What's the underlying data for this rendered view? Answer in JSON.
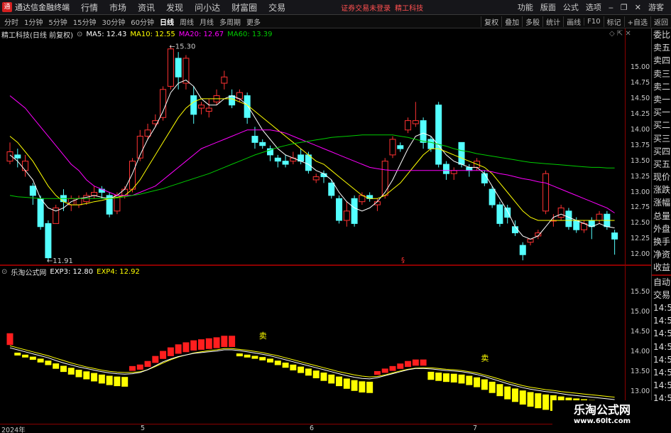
{
  "app": {
    "name": "通达信金融终端",
    "logo": "通",
    "menus": [
      "行情",
      "市场",
      "资讯",
      "发现",
      "问小达",
      "财富圈",
      "交易"
    ],
    "warning": "证券交易未登录",
    "stock_name_top": "精工科技",
    "right_menus": [
      "功能",
      "版面",
      "公式",
      "选项"
    ],
    "window_icons": [
      "minimize-icon",
      "restore-icon",
      "close-icon"
    ],
    "user": "游客"
  },
  "toolbar": {
    "periods": [
      "分时",
      "1分钟",
      "5分钟",
      "15分钟",
      "30分钟",
      "60分钟",
      "日线",
      "周线",
      "月线",
      "多周期",
      "更多"
    ],
    "active": "日线",
    "right": [
      "复权",
      "叠加",
      "多股",
      "统计",
      "画线",
      "F10",
      "标记",
      "+自选",
      "返回"
    ]
  },
  "main": {
    "title": "精工科技(日线 前复权)",
    "ma": [
      {
        "label": "MA5: 12.43",
        "color": "#ffffff"
      },
      {
        "label": "MA10: 12.55",
        "color": "#ffff00"
      },
      {
        "label": "MA20: 12.67",
        "color": "#ff00ff"
      },
      {
        "label": "MA60: 13.39",
        "color": "#00cc00"
      }
    ],
    "high_label": "15.30",
    "low_label": "11.91",
    "mid_marker": "§"
  },
  "price_axis": [
    "15.00",
    "14.75",
    "14.50",
    "14.25",
    "14.00",
    "13.75",
    "13.50",
    "13.25",
    "13.00",
    "12.75",
    "12.50",
    "12.25",
    "12.00"
  ],
  "sub": {
    "title": "乐淘公式网",
    "exp": [
      {
        "label": "EXP3: 12.80",
        "color": "#ffffff"
      },
      {
        "label": "EXP4: 12.92",
        "color": "#ffff00"
      }
    ],
    "sell": "卖"
  },
  "sub_axis": [
    "15.50",
    "15.00",
    "14.50",
    "14.00",
    "13.50",
    "13.00",
    "12.50"
  ],
  "side_quote": [
    "委比",
    "卖五",
    "卖四",
    "卖三",
    "卖二",
    "卖一",
    "买一",
    "买二",
    "买三",
    "买四",
    "买五",
    "现价",
    "涨跌",
    "涨幅",
    "总量",
    "外盘",
    "换手",
    "净资",
    "收益"
  ],
  "side_sub": [
    "自动",
    "交易",
    "14:56",
    "14:56",
    "14:56",
    "14:56",
    "14:56",
    "14:56",
    "14:56",
    "14:56"
  ],
  "xaxis": [
    {
      "t": "2024年",
      "x": 2
    },
    {
      "t": "5",
      "x": 198
    },
    {
      "t": "6",
      "x": 436
    },
    {
      "t": "7",
      "x": 666
    }
  ],
  "watermark": {
    "line1": "乐淘公式网",
    "line2": "www.60lt.com"
  },
  "chart_data": {
    "type": "candlestick",
    "ylim": [
      11.9,
      15.4
    ],
    "candles": [
      [
        13.5,
        13.65,
        13.45,
        13.8
      ],
      [
        13.6,
        13.55,
        13.4,
        13.7
      ],
      [
        13.35,
        13.5,
        13.25,
        13.6
      ],
      [
        13.1,
        12.95,
        12.8,
        13.15
      ],
      [
        12.9,
        12.45,
        12.4,
        12.95
      ],
      [
        12.5,
        11.95,
        11.9,
        12.55
      ],
      [
        12.5,
        12.75,
        12.5,
        12.8
      ],
      [
        12.95,
        12.85,
        12.7,
        13.05
      ],
      [
        12.8,
        12.9,
        12.7,
        12.95
      ],
      [
        12.8,
        12.9,
        12.75,
        12.95
      ],
      [
        12.85,
        12.95,
        12.8,
        13.0
      ],
      [
        12.95,
        13.0,
        12.9,
        13.1
      ],
      [
        13.05,
        13.0,
        12.9,
        13.1
      ],
      [
        12.95,
        12.65,
        12.6,
        13.0
      ],
      [
        12.7,
        12.95,
        12.65,
        13.0
      ],
      [
        12.95,
        13.05,
        12.9,
        13.1
      ],
      [
        13.05,
        13.5,
        13.0,
        13.55
      ],
      [
        13.55,
        13.9,
        13.5,
        14.0
      ],
      [
        13.9,
        14.0,
        13.85,
        14.1
      ],
      [
        14.1,
        14.15,
        14.05,
        14.25
      ],
      [
        14.2,
        14.65,
        14.15,
        14.7
      ],
      [
        14.7,
        15.3,
        14.65,
        15.35
      ],
      [
        15.15,
        14.85,
        14.65,
        15.25
      ],
      [
        14.75,
        15.15,
        14.65,
        15.2
      ],
      [
        14.55,
        14.25,
        14.1,
        14.7
      ],
      [
        14.35,
        14.4,
        14.25,
        14.45
      ],
      [
        14.3,
        14.35,
        14.2,
        14.5
      ],
      [
        14.45,
        14.55,
        14.4,
        14.65
      ],
      [
        14.75,
        14.85,
        14.65,
        14.95
      ],
      [
        14.55,
        14.4,
        14.35,
        14.65
      ],
      [
        14.5,
        14.6,
        14.45,
        14.65
      ],
      [
        14.55,
        14.2,
        14.1,
        14.6
      ],
      [
        13.9,
        13.8,
        13.7,
        14.05
      ],
      [
        13.8,
        13.75,
        13.7,
        13.85
      ],
      [
        13.7,
        13.6,
        13.5,
        13.75
      ],
      [
        13.55,
        13.5,
        13.4,
        13.6
      ],
      [
        13.5,
        13.45,
        13.4,
        13.6
      ],
      [
        13.5,
        13.55,
        13.45,
        13.65
      ],
      [
        13.6,
        13.5,
        13.45,
        13.7
      ],
      [
        13.6,
        13.35,
        13.3,
        13.65
      ],
      [
        13.2,
        13.25,
        13.15,
        13.3
      ],
      [
        13.3,
        13.25,
        13.15,
        13.35
      ],
      [
        13.15,
        12.95,
        12.9,
        13.2
      ],
      [
        12.9,
        12.55,
        12.5,
        12.95
      ],
      [
        12.55,
        12.7,
        12.45,
        12.85
      ],
      [
        12.9,
        12.5,
        12.45,
        12.95
      ],
      [
        12.85,
        12.95,
        12.8,
        13.0
      ],
      [
        12.95,
        12.9,
        12.85,
        13.0
      ],
      [
        12.8,
        12.85,
        12.7,
        12.9
      ],
      [
        12.95,
        13.5,
        12.9,
        13.55
      ],
      [
        13.6,
        13.85,
        13.55,
        13.9
      ],
      [
        13.75,
        13.7,
        13.65,
        13.8
      ],
      [
        14.0,
        14.15,
        13.95,
        14.2
      ],
      [
        14.1,
        14.15,
        14.05,
        14.45
      ],
      [
        14.15,
        13.8,
        13.7,
        14.2
      ],
      [
        13.85,
        13.7,
        13.65,
        13.9
      ],
      [
        14.4,
        13.45,
        13.4,
        14.45
      ],
      [
        13.45,
        13.3,
        13.2,
        13.5
      ],
      [
        13.3,
        13.35,
        13.2,
        13.4
      ],
      [
        13.8,
        13.45,
        13.4,
        13.8
      ],
      [
        13.4,
        13.35,
        13.25,
        13.45
      ],
      [
        13.4,
        13.5,
        13.35,
        13.55
      ],
      [
        13.3,
        13.15,
        13.1,
        13.35
      ],
      [
        13.05,
        12.8,
        12.75,
        13.1
      ],
      [
        12.8,
        12.5,
        12.45,
        12.85
      ],
      [
        12.75,
        12.6,
        12.5,
        12.8
      ],
      [
        12.45,
        12.35,
        12.3,
        12.55
      ],
      [
        12.15,
        12.0,
        11.91,
        12.2
      ],
      [
        12.2,
        12.25,
        12.15,
        12.25
      ],
      [
        12.3,
        12.35,
        12.25,
        12.4
      ],
      [
        12.7,
        13.3,
        12.65,
        13.35
      ],
      [
        12.55,
        12.55,
        12.45,
        12.65
      ],
      [
        12.6,
        12.75,
        12.55,
        12.8
      ],
      [
        12.7,
        12.45,
        12.4,
        12.75
      ],
      [
        12.55,
        12.4,
        12.35,
        12.6
      ],
      [
        12.4,
        12.5,
        12.35,
        12.55
      ],
      [
        12.55,
        12.45,
        12.25,
        12.6
      ],
      [
        12.55,
        12.65,
        12.5,
        12.7
      ],
      [
        12.65,
        12.45,
        12.4,
        12.7
      ],
      [
        12.35,
        12.25,
        12.0,
        12.4
      ]
    ],
    "ma5": [
      13.6,
      13.5,
      13.35,
      13.2,
      12.9,
      12.75,
      12.7,
      12.75,
      12.85,
      12.9,
      12.92,
      12.95,
      12.92,
      12.9,
      12.95,
      13.05,
      13.3,
      13.6,
      13.85,
      14.05,
      14.3,
      14.6,
      14.75,
      14.8,
      14.7,
      14.5,
      14.4,
      14.4,
      14.5,
      14.55,
      14.5,
      14.4,
      14.2,
      14.0,
      13.85,
      13.7,
      13.6,
      13.55,
      13.5,
      13.45,
      13.35,
      13.3,
      13.2,
      13.0,
      12.85,
      12.75,
      12.7,
      12.75,
      12.85,
      13.0,
      13.2,
      13.45,
      13.7,
      13.9,
      13.95,
      13.9,
      13.75,
      13.6,
      13.5,
      13.45,
      13.4,
      13.4,
      13.3,
      13.1,
      12.9,
      12.7,
      12.45,
      12.3,
      12.25,
      12.3,
      12.45,
      12.6,
      12.65,
      12.6,
      12.55,
      12.5,
      12.45,
      12.5,
      12.45,
      12.43
    ],
    "ma10": [
      13.9,
      13.8,
      13.65,
      13.5,
      13.3,
      13.1,
      12.95,
      12.85,
      12.8,
      12.8,
      12.82,
      12.85,
      12.87,
      12.9,
      12.92,
      12.95,
      13.05,
      13.2,
      13.4,
      13.6,
      13.8,
      14.0,
      14.2,
      14.35,
      14.45,
      14.5,
      14.5,
      14.5,
      14.5,
      14.5,
      14.45,
      14.4,
      14.3,
      14.2,
      14.1,
      14.0,
      13.9,
      13.8,
      13.7,
      13.6,
      13.5,
      13.45,
      13.35,
      13.25,
      13.15,
      13.05,
      12.95,
      12.9,
      12.9,
      12.95,
      13.05,
      13.15,
      13.3,
      13.45,
      13.6,
      13.7,
      13.7,
      13.65,
      13.6,
      13.55,
      13.5,
      13.45,
      13.4,
      13.3,
      13.15,
      13.0,
      12.85,
      12.7,
      12.6,
      12.55,
      12.55,
      12.55,
      12.55,
      12.55,
      12.55,
      12.55,
      12.55,
      12.55,
      12.55,
      12.55
    ],
    "ma20": [
      14.55,
      14.45,
      14.35,
      14.2,
      14.05,
      13.9,
      13.75,
      13.6,
      13.45,
      13.35,
      13.2,
      13.1,
      13.05,
      13.0,
      12.95,
      12.95,
      12.95,
      13.0,
      13.05,
      13.1,
      13.2,
      13.3,
      13.4,
      13.5,
      13.6,
      13.7,
      13.75,
      13.8,
      13.85,
      13.9,
      13.95,
      14.0,
      14.0,
      14.0,
      14.0,
      13.98,
      13.95,
      13.9,
      13.85,
      13.8,
      13.75,
      13.7,
      13.65,
      13.6,
      13.55,
      13.5,
      13.45,
      13.4,
      13.38,
      13.36,
      13.35,
      13.35,
      13.35,
      13.35,
      13.35,
      13.35,
      13.35,
      13.35,
      13.35,
      13.35,
      13.35,
      13.35,
      13.35,
      13.33,
      13.3,
      13.28,
      13.25,
      13.22,
      13.2,
      13.17,
      13.15,
      13.1,
      13.05,
      13.0,
      12.95,
      12.9,
      12.85,
      12.8,
      12.75,
      12.67
    ],
    "ma60": [
      12.95,
      12.93,
      12.92,
      12.91,
      12.9,
      12.9,
      12.9,
      12.9,
      12.9,
      12.9,
      12.9,
      12.9,
      12.9,
      12.9,
      12.91,
      12.93,
      12.95,
      12.97,
      13.0,
      13.03,
      13.06,
      13.1,
      13.14,
      13.18,
      13.22,
      13.26,
      13.3,
      13.35,
      13.4,
      13.45,
      13.5,
      13.55,
      13.6,
      13.64,
      13.68,
      13.72,
      13.75,
      13.78,
      13.8,
      13.82,
      13.84,
      13.86,
      13.88,
      13.89,
      13.9,
      13.91,
      13.92,
      13.92,
      13.92,
      13.92,
      13.92,
      13.9,
      13.88,
      13.85,
      13.82,
      13.8,
      13.77,
      13.74,
      13.7,
      13.67,
      13.65,
      13.62,
      13.6,
      13.58,
      13.56,
      13.54,
      13.52,
      13.5,
      13.48,
      13.47,
      13.46,
      13.45,
      13.44,
      13.43,
      13.42,
      13.41,
      13.4,
      13.4,
      13.39,
      13.39
    ],
    "sub_ylim": [
      12.3,
      15.8
    ],
    "exp3": [
      14.1,
      14.05,
      14.0,
      13.95,
      13.9,
      13.85,
      13.78,
      13.72,
      13.67,
      13.62,
      13.58,
      13.54,
      13.5,
      13.47,
      13.45,
      13.44,
      13.45,
      13.48,
      13.55,
      13.65,
      13.75,
      13.82,
      13.88,
      13.92,
      13.96,
      13.98,
      14.0,
      14.02,
      14.05,
      14.05,
      14.03,
      14.0,
      13.97,
      13.94,
      13.9,
      13.85,
      13.8,
      13.75,
      13.7,
      13.65,
      13.6,
      13.55,
      13.5,
      13.45,
      13.4,
      13.36,
      13.33,
      13.32,
      13.35,
      13.4,
      13.45,
      13.5,
      13.55,
      13.58,
      13.58,
      13.57,
      13.55,
      13.53,
      13.52,
      13.5,
      13.47,
      13.43,
      13.38,
      13.32,
      13.26,
      13.2,
      13.15,
      13.1,
      13.06,
      13.03,
      13.0,
      12.98,
      12.95,
      12.92,
      12.9,
      12.88,
      12.86,
      12.84,
      12.82,
      12.8
    ],
    "exp4": [
      14.15,
      14.1,
      14.05,
      14.0,
      13.95,
      13.9,
      13.84,
      13.78,
      13.72,
      13.67,
      13.62,
      13.58,
      13.54,
      13.51,
      13.49,
      13.48,
      13.48,
      13.5,
      13.55,
      13.63,
      13.72,
      13.8,
      13.87,
      13.92,
      13.97,
      14.0,
      14.03,
      14.05,
      14.08,
      14.08,
      14.06,
      14.04,
      14.01,
      13.98,
      13.94,
      13.9,
      13.85,
      13.8,
      13.75,
      13.7,
      13.65,
      13.6,
      13.55,
      13.5,
      13.46,
      13.42,
      13.39,
      13.37,
      13.38,
      13.42,
      13.47,
      13.52,
      13.56,
      13.59,
      13.6,
      13.6,
      13.58,
      13.56,
      13.55,
      13.53,
      13.5,
      13.47,
      13.42,
      13.37,
      13.31,
      13.25,
      13.2,
      13.15,
      13.11,
      13.08,
      13.05,
      13.03,
      13.0,
      12.98,
      12.96,
      12.94,
      12.92,
      12.9,
      12.88,
      12.86
    ]
  }
}
